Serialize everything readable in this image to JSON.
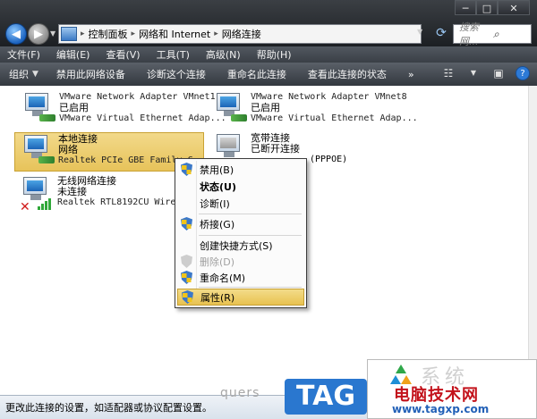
{
  "window": {
    "controls": [
      "─",
      "□",
      "✕"
    ]
  },
  "address": {
    "crumbs": [
      "控制面板",
      "网络和 Internet",
      "网络连接"
    ],
    "search_placeholder": "搜索 网..."
  },
  "menubar": [
    "文件(F)",
    "编辑(E)",
    "查看(V)",
    "工具(T)",
    "高级(N)",
    "帮助(H)"
  ],
  "toolbar": {
    "items": [
      "组织",
      "禁用此网络设备",
      "诊断这个连接",
      "重命名此连接",
      "查看此连接的状态"
    ],
    "more": "»"
  },
  "connections": [
    {
      "name": "VMware Network Adapter VMnet1",
      "status": "已启用",
      "device": "VMware Virtual Ethernet Adap..."
    },
    {
      "name": "VMware Network Adapter VMnet8",
      "status": "已启用",
      "device": "VMware Virtual Ethernet Adap..."
    },
    {
      "name": "本地连接",
      "status": "网络",
      "device": "Realtek PCIe GBE Family C"
    },
    {
      "name": "宽带连接",
      "status": "已断开连接",
      "device": "(PPPOE)"
    },
    {
      "name": "无线网络连接",
      "status": "未连接",
      "device": "Realtek RTL8192CU Wireless"
    }
  ],
  "context_menu": {
    "items": [
      "禁用(B)",
      "状态(U)",
      "诊断(I)",
      "桥接(G)",
      "创建快捷方式(S)",
      "删除(D)",
      "重命名(M)",
      "属性(R)"
    ]
  },
  "status_bar": "更改此连接的设置，如适配器或协议配置设置。",
  "watermarks": {
    "quers": "quers",
    "tag": "TAG",
    "xitong": "系统",
    "brand": "电脑技术网",
    "url": "www.tagxp.com"
  },
  "colors": {
    "selection": "#e7c35a",
    "toolbar": "#3a3f46",
    "brand_red": "#c3121b",
    "tag_blue": "#2a77cf"
  }
}
